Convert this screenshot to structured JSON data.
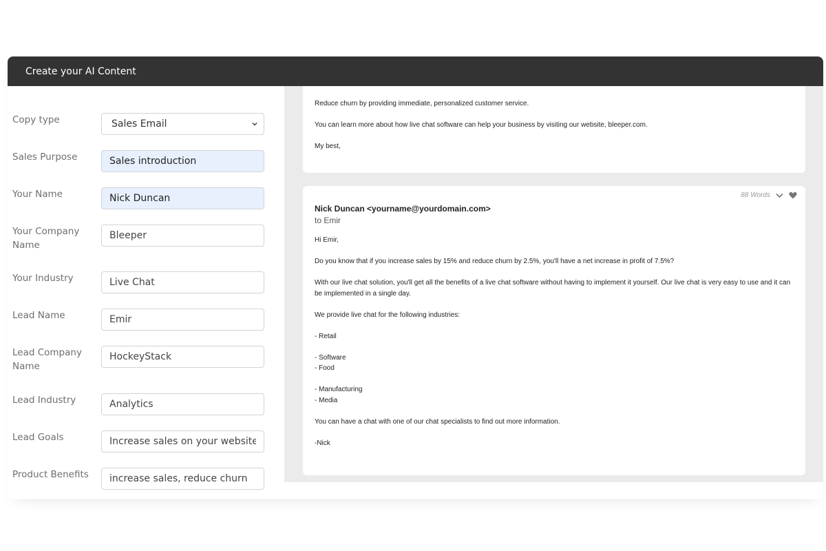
{
  "window": {
    "title": "Create your AI Content"
  },
  "form": {
    "copy_type": {
      "label": "Copy type",
      "value": "Sales Email"
    },
    "sales_purpose": {
      "label": "Sales Purpose",
      "value": "Sales introduction"
    },
    "your_name": {
      "label": "Your Name",
      "value": "Nick Duncan"
    },
    "your_company": {
      "label": "Your Company Name",
      "value": "Bleeper"
    },
    "your_industry": {
      "label": "Your Industry",
      "value": "Live Chat"
    },
    "lead_name": {
      "label": "Lead Name",
      "value": "Emir"
    },
    "lead_company": {
      "label": "Lead Company Name",
      "value": "HockeyStack"
    },
    "lead_industry": {
      "label": "Lead Industry",
      "value": "Analytics"
    },
    "lead_goals": {
      "label": "Lead Goals",
      "value": "Increase sales on your website th"
    },
    "product_benefits": {
      "label": "Product Benefits",
      "value": "increase sales, reduce churn"
    }
  },
  "card1": {
    "p1": "Reduce churn by providing immediate, personalized customer service.",
    "p2": "You can learn more about how live chat software can help your business by visiting our website, bleeper.com.",
    "p3": "My best,"
  },
  "card2": {
    "word_count": "88 Words",
    "from": "Nick Duncan <yourname@yourdomain.com>",
    "to": "to Emir",
    "greeting": "Hi Emir,",
    "p1": "Do you know that if you increase sales by 15% and reduce churn by 2.5%, you'll have a net increase in profit of 7.5%?",
    "p2": "With our live chat solution, you'll get all the benefits of a live chat software without having to implement it yourself. Our live chat is very easy to use and it can be implemented in a single day.",
    "p3": "We provide live chat for the following industries:",
    "i1": "- Retail",
    "i2": "- Software",
    "i3": "- Food",
    "i4": "- Manufacturing",
    "i5": "- Media",
    "p4": "You can have a chat with one of our chat specialists to find out more information.",
    "sign": "-Nick"
  },
  "icons": {
    "select_chevron": "chevron-down-icon",
    "expand": "chevron-down-icon",
    "favorite": "heart-icon"
  }
}
